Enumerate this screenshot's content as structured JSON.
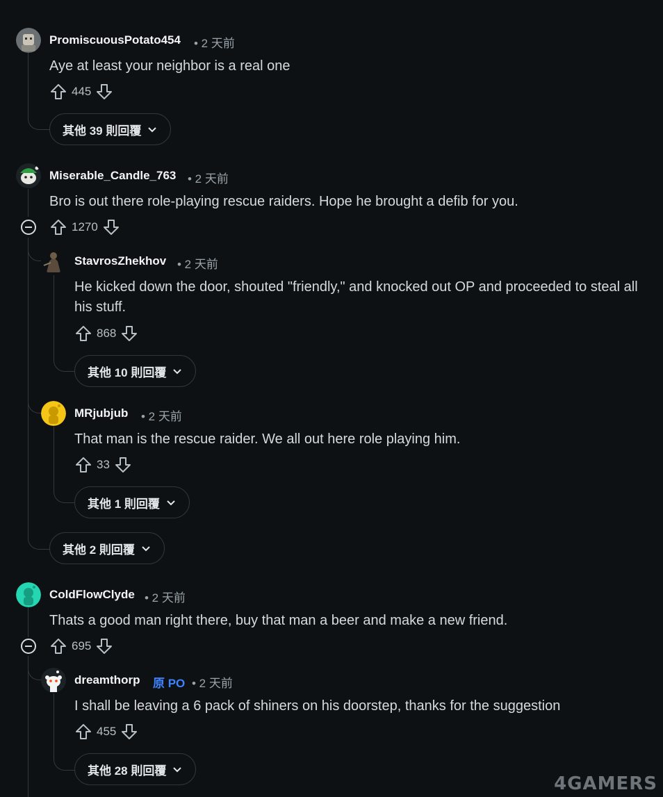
{
  "comments": [
    {
      "user": "PromiscuousPotato454",
      "time": "• 2 天前",
      "text": "Aye at least your neighbor is a real one",
      "votes": "445",
      "more": "其他 39 則回覆"
    },
    {
      "user": "Miserable_Candle_763",
      "time": "• 2 天前",
      "text": "Bro is out there role-playing rescue raiders. Hope he brought a defib for you.",
      "votes": "1270",
      "more": "其他 2 則回覆"
    },
    {
      "user": "StavrosZhekhov",
      "time": "• 2 天前",
      "text": "He kicked down the door, shouted \"friendly,\" and knocked out OP and proceeded to steal all his stuff.",
      "votes": "868",
      "more": "其他 10 則回覆"
    },
    {
      "user": "MRjubjub",
      "time": "• 2 天前",
      "text": "That man is the rescue raider. We all out here role playing him.",
      "votes": "33",
      "more": "其他 1 則回覆"
    },
    {
      "user": "ColdFlowClyde",
      "time": "• 2 天前",
      "text": "Thats a good man right there, buy that man a beer and make a new friend.",
      "votes": "695"
    },
    {
      "user": "dreamthorp",
      "op_badge": "原 PO",
      "time": "• 2 天前",
      "text": "I shall be leaving a 6 pack of shiners on his doorstep, thanks for the suggestion",
      "votes": "455",
      "more": "其他 28 則回覆"
    }
  ],
  "watermark": "4GAMERS",
  "colors": {
    "background": "#0e1113",
    "op_badge": "#3d83ff",
    "thread_line": "#33393d"
  }
}
